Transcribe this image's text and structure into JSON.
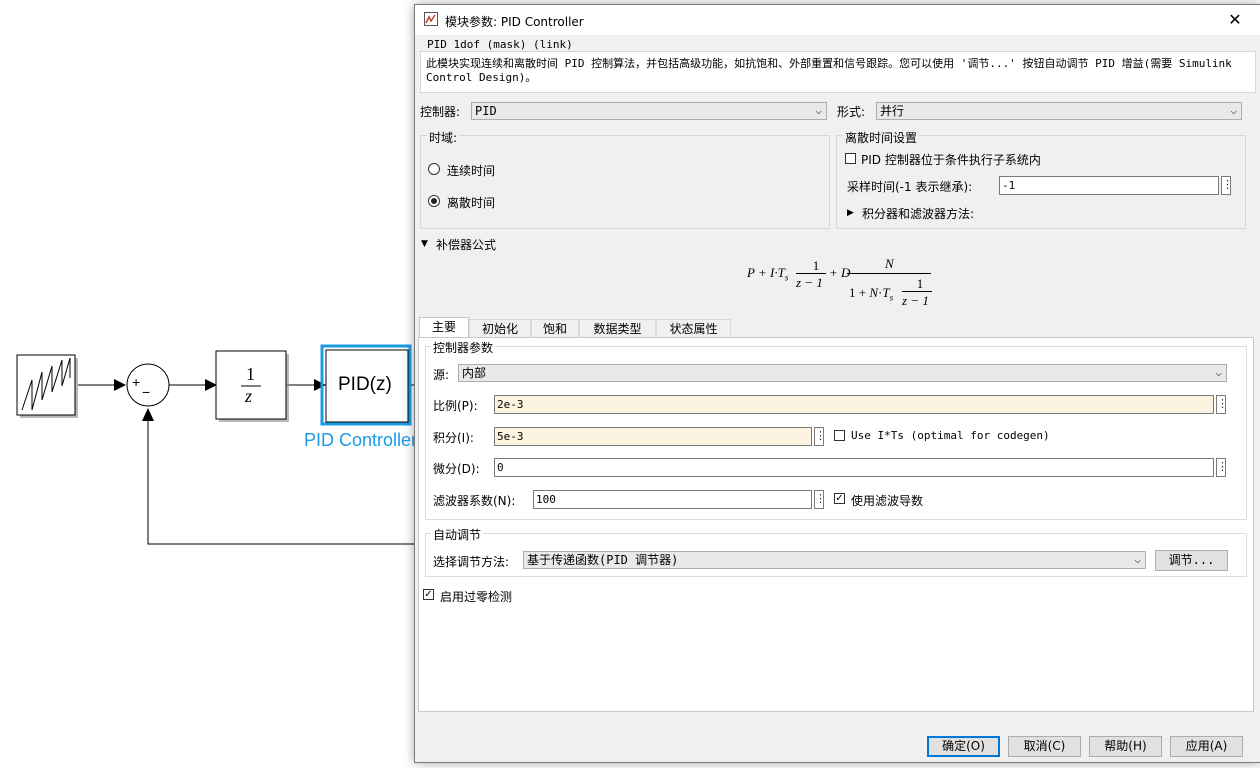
{
  "canvas": {
    "integrator_num": "1",
    "integrator_den": "z",
    "pid_block_text": "PID(z)",
    "pid_block_name": "PID Controller",
    "sum_plus": "+",
    "sum_minus": "−"
  },
  "dialog": {
    "title": "模块参数: PID Controller",
    "header": "PID 1dof (mask) (link)",
    "description": "此模块实现连续和离散时间 PID 控制算法，并包括高级功能，如抗饱和、外部重置和信号跟踪。您可以使用 '调节...' 按钮自动调节 PID 增益(需要 Simulink Control Design)。",
    "controller_label": "控制器:",
    "controller_value": "PID",
    "form_label": "形式:",
    "form_value": "并行",
    "time_domain": {
      "title": "时域:",
      "continuous": "连续时间",
      "discrete": "离散时间",
      "selected": "discrete"
    },
    "discrete_settings": {
      "title": "离散时间设置",
      "triggered_label": "PID 控制器位于条件执行子系统内",
      "triggered_checked": false,
      "sample_time_label": "采样时间(-1 表示继承):",
      "sample_time_value": "-1",
      "integrator_methods_label": "积分器和滤波器方法:"
    },
    "compensator": {
      "title": "补偿器公式",
      "formula": {
        "P": "P",
        "I": "I",
        "Ts": "T",
        "s": "s",
        "D": "D",
        "N": "N",
        "one": "1",
        "z1": "z − 1"
      }
    },
    "tabs": [
      "主要",
      "初始化",
      "饱和",
      "数据类型",
      "状态属性"
    ],
    "active_tab": 0,
    "params": {
      "title": "控制器参数",
      "source_label": "源:",
      "source_value": "内部",
      "p_label": "比例(P):",
      "p_value": "2e-3",
      "i_label": "积分(I):",
      "i_value": "5e-3",
      "use_its_label": "Use I*Ts (optimal for codegen)",
      "use_its_checked": false,
      "d_label": "微分(D):",
      "d_value": "0",
      "n_label": "滤波器系数(N):",
      "n_value": "100",
      "filter_label": "使用滤波导数",
      "filter_checked": true
    },
    "autotune": {
      "title": "自动调节",
      "method_label": "选择调节方法:",
      "method_value": "基于传递函数(PID 调节器)",
      "tune_button": "调节..."
    },
    "zero_crossing_label": "启用过零检测",
    "zero_crossing_checked": true,
    "buttons": {
      "ok": "确定(O)",
      "cancel": "取消(C)",
      "help": "帮助(H)",
      "apply": "应用(A)"
    }
  },
  "colors": {
    "accent": "#0078d7",
    "block_highlight": "#1a9be6",
    "tuned_field": "#fdf3e1"
  }
}
